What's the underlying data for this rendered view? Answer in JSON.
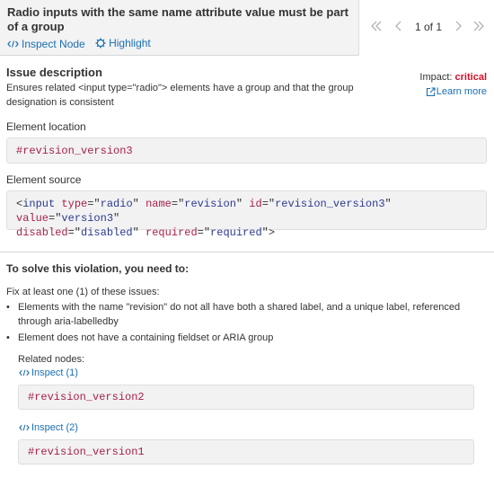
{
  "header": {
    "title": "Radio inputs with the same name attribute value must be part of a group",
    "inspect_node": "Inspect Node",
    "highlight": "Highlight",
    "pager_text": "1 of 1"
  },
  "issue": {
    "heading": "Issue description",
    "description": "Ensures related <input type=\"radio\"> elements have a group and that the group designation is consistent",
    "impact_label": "Impact:",
    "impact_value": "critical",
    "learn_more": "Learn more"
  },
  "location": {
    "label": "Element location",
    "selector": "#revision_version3"
  },
  "source": {
    "label": "Element source",
    "tag": "input",
    "attributes": [
      {
        "name": "type",
        "value": "radio"
      },
      {
        "name": "name",
        "value": "revision"
      },
      {
        "name": "id",
        "value": "revision_version3"
      },
      {
        "name": "value",
        "value": "version3"
      },
      {
        "name": "disabled",
        "value": "disabled"
      },
      {
        "name": "required",
        "value": "required"
      }
    ]
  },
  "solution": {
    "heading": "To solve this violation, you need to:",
    "fix_intro": "Fix at least one (1) of these issues:",
    "issues": [
      "Elements with the name \"revision\" do not all have both a shared label, and a unique label, referenced through aria-labelledby",
      "Element does not have a containing fieldset or ARIA group"
    ],
    "related_label": "Related nodes:",
    "related_nodes": [
      {
        "link": "Inspect (1)",
        "selector": "#revision_version2"
      },
      {
        "link": "Inspect (2)",
        "selector": "#revision_version1"
      }
    ]
  },
  "colors": {
    "link": "#1a6fb3",
    "critical": "#d0102a",
    "selector": "#a6204a"
  },
  "icons": {
    "inspect": "code-icon",
    "highlight": "gear-icon",
    "learn_more": "external-link-icon",
    "pager": [
      "double-chevron-left-icon",
      "chevron-left-icon",
      "chevron-right-icon",
      "double-chevron-right-icon"
    ]
  }
}
